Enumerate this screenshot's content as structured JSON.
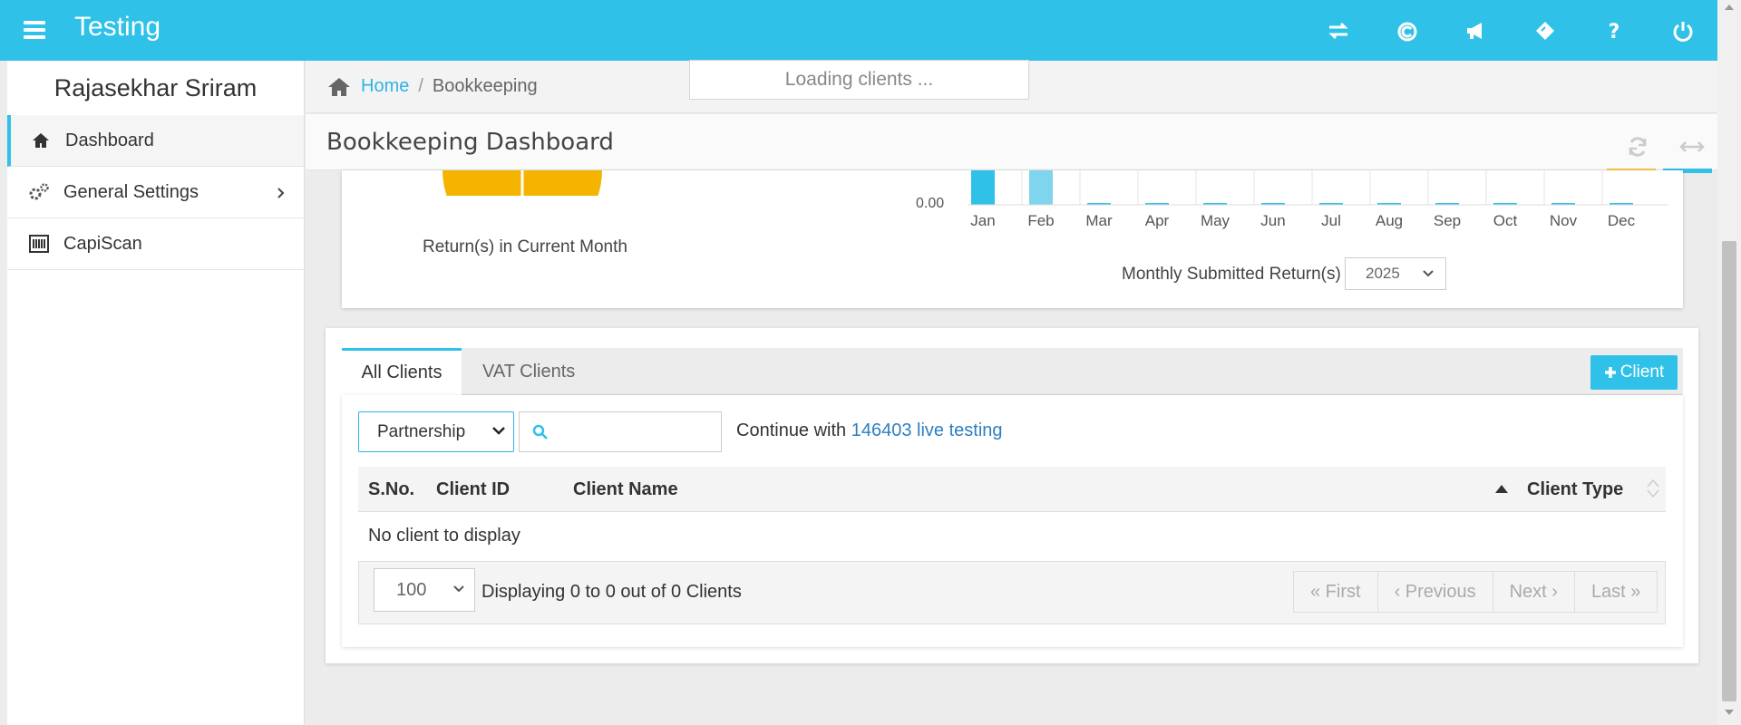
{
  "app": {
    "title": "Testing"
  },
  "topbar": {
    "icons": [
      "transfer-icon",
      "copyright-icon",
      "megaphone-icon",
      "ticket-icon",
      "help-icon",
      "power-icon"
    ]
  },
  "sidebar": {
    "user_name": "Rajasekhar Sriram",
    "items": [
      {
        "label": "Dashboard",
        "icon": "home-icon"
      },
      {
        "label": "General Settings",
        "icon": "gears-icon"
      },
      {
        "label": "CapiScan",
        "icon": "barcode-icon"
      }
    ]
  },
  "breadcrumb": {
    "home": "Home",
    "separator": "/",
    "current": "Bookkeeping"
  },
  "loading": "Loading clients ...",
  "panel": {
    "title": "Bookkeeping Dashboard"
  },
  "colors": {
    "accent": "#2fc1e8",
    "pie": "#f4b400",
    "link": "#2d7fc1"
  },
  "charts": {
    "pie_caption": "Return(s) in Current Month",
    "monthly_label": "Monthly Submitted Return(s)",
    "year": "2025",
    "y_tick_zero": "0.00"
  },
  "chart_data": {
    "type": "bar",
    "categories": [
      "Jan",
      "Feb",
      "Mar",
      "Apr",
      "May",
      "Jun",
      "Jul",
      "Aug",
      "Sep",
      "Oct",
      "Nov",
      "Dec"
    ],
    "values": [
      2,
      1,
      0,
      0,
      0,
      0,
      0,
      0,
      0,
      0,
      0,
      0
    ],
    "title": "",
    "xlabel": "",
    "ylabel": ""
  },
  "clients": {
    "tabs": [
      "All Clients",
      "VAT Clients"
    ],
    "add_button": "Client",
    "type_filter": "Partnership",
    "continue_prefix": "Continue with",
    "continue_link": "146403 live testing",
    "columns": [
      "S.No.",
      "Client ID",
      "Client Name",
      "Client Type"
    ],
    "empty": "No client to display",
    "page_size": "100",
    "display_text": "Displaying 0 to 0 out of 0 Clients",
    "pager": {
      "first": "« First",
      "previous": "‹ Previous",
      "next": "Next ›",
      "last": "Last »"
    }
  }
}
